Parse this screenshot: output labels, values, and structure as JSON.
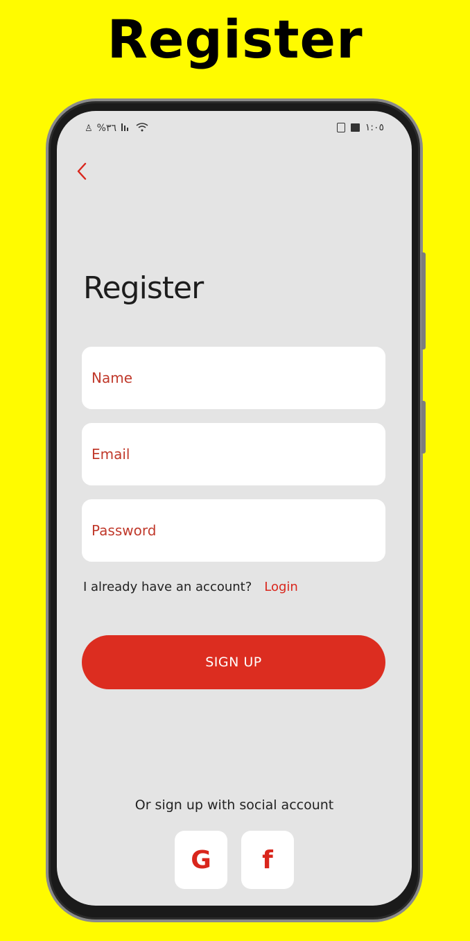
{
  "banner": {
    "title": "Register"
  },
  "status_bar": {
    "left_text": "%٣٦",
    "right_time": "١:٠٥"
  },
  "page": {
    "title": "Register"
  },
  "form": {
    "name_placeholder": "Name",
    "email_placeholder": "Email",
    "password_placeholder": "Password"
  },
  "account": {
    "prompt": "I already have an account?",
    "login_label": "Login"
  },
  "signup": {
    "label": "SIGN UP"
  },
  "social": {
    "caption": "Or sign up with social account",
    "google_glyph": "G",
    "facebook_glyph": "f"
  },
  "colors": {
    "background": "#FFFB00",
    "accent": "#DC2D20",
    "screen": "#E4E4E4"
  },
  "icons": [
    "back-arrow-icon",
    "google-icon",
    "facebook-icon",
    "wifi-icon",
    "signal-icon",
    "battery-icon",
    "image-icon"
  ]
}
